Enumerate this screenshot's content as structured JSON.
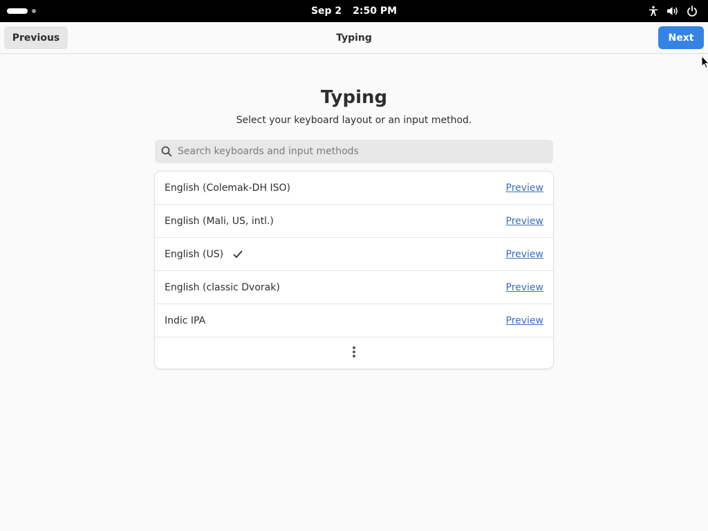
{
  "topbar": {
    "date": "Sep 2",
    "time": "2:50 PM",
    "tray_icons": [
      "accessibility-icon",
      "volume-icon",
      "power-icon"
    ]
  },
  "headerbar": {
    "previous_label": "Previous",
    "title": "Typing",
    "next_label": "Next"
  },
  "main": {
    "title": "Typing",
    "subtitle": "Select your keyboard layout or an input method.",
    "search": {
      "placeholder": "Search keyboards and input methods",
      "value": ""
    },
    "layouts": [
      {
        "label": "English (Colemak-DH ISO)",
        "selected": false,
        "action": "Preview"
      },
      {
        "label": "English (Mali, US, intl.)",
        "selected": false,
        "action": "Preview"
      },
      {
        "label": "English (US)",
        "selected": true,
        "action": "Preview"
      },
      {
        "label": "English (classic Dvorak)",
        "selected": false,
        "action": "Preview"
      },
      {
        "label": "Indic IPA",
        "selected": false,
        "action": "Preview"
      }
    ]
  },
  "colors": {
    "accent": "#3584e4",
    "link": "#3b6fb6",
    "background": "#fafafa",
    "topbar": "#000000"
  }
}
